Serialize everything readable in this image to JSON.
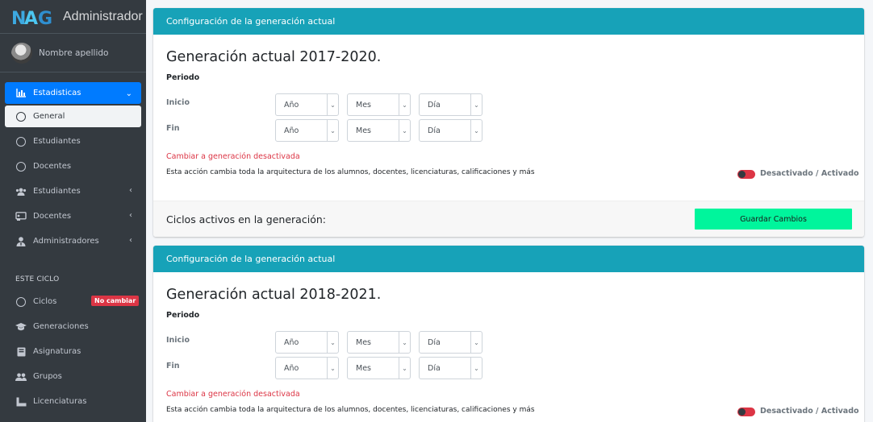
{
  "brand": {
    "logo_text": "NAG",
    "title": "Administrador"
  },
  "user": {
    "name": "Nombre apellido"
  },
  "sidebar": {
    "items": [
      {
        "label": "Estadisticas",
        "icon": "chart-icon"
      },
      {
        "label": "General",
        "icon": "circle-icon"
      },
      {
        "label": "Estudiantes",
        "icon": "circle-icon"
      },
      {
        "label": "Docentes",
        "icon": "circle-icon"
      },
      {
        "label": "Estudiantes",
        "icon": "users-icon"
      },
      {
        "label": "Docentes",
        "icon": "chalkboard-icon"
      },
      {
        "label": "Administradores",
        "icon": "user-tie-icon"
      }
    ],
    "section_header": "ESTE CICLO",
    "section_items": [
      {
        "label": "Ciclos",
        "icon": "circle-icon",
        "badge": "No cambiar"
      },
      {
        "label": "Generaciones",
        "icon": "graduation-cap-icon"
      },
      {
        "label": "Asignaturas",
        "icon": "book-icon"
      },
      {
        "label": "Grupos",
        "icon": "users-icon"
      },
      {
        "label": "Licenciaturas",
        "icon": "certificate-icon"
      }
    ]
  },
  "cards": [
    {
      "header": "Configuración de la generación actual",
      "title": "Generación actual 2017-2020.",
      "periodo": "Periodo",
      "inicio": "Inicio",
      "fin": "Fin",
      "selects": {
        "year": "Año",
        "month": "Mes",
        "day": "Día"
      },
      "warning": "Cambiar a generación desactivada",
      "description": "Esta acción cambia toda la arquitectura de los alumnos, docentes, licenciaturas, calificaciones y más",
      "toggle_label": "Desactivado / Activado",
      "footer_text": "Ciclos activos en la generación:",
      "save_label": "Guardar Cambios"
    },
    {
      "header": "Configuración de la generación actual",
      "title": "Generación actual 2018-2021.",
      "periodo": "Periodo",
      "inicio": "Inicio",
      "fin": "Fin",
      "selects": {
        "year": "Año",
        "month": "Mes",
        "day": "Día"
      },
      "warning": "Cambiar a generación desactivada",
      "description": "Esta acción cambia toda la arquitectura de los alumnos, docentes, licenciaturas, calificaciones y más",
      "toggle_label": "Desactivado / Activado"
    }
  ],
  "colors": {
    "sidebar": "#343a40",
    "active": "#007bff",
    "card_header": "#17a2b8",
    "save_button": "#00f59c",
    "warning": "#dc3545"
  }
}
